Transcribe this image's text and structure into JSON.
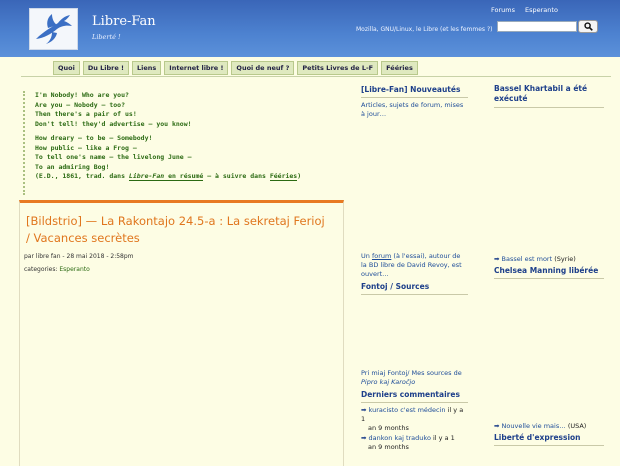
{
  "site": {
    "title": "Libre-Fan",
    "tagline": "Liberté !"
  },
  "top_links": [
    "Forums",
    "Esperanto"
  ],
  "header_blurb": "Mozilla, GNU/Linux, le Libre (et les femmes ?)",
  "search": {
    "placeholder": "",
    "button_icon": "search-icon"
  },
  "tabs": [
    "Quoi",
    "Du Libre !",
    "Liens",
    "Internet libre !",
    "Quoi de neuf ?",
    "Petits Livres de L-F",
    "Fééries"
  ],
  "poem": {
    "lines": [
      "I'm Nobody! Who are you?",
      "Are you — Nobody — too?",
      "Then there's a pair of us!",
      "Don't tell! they'd advertise — you know!",
      "How dreary — to be — Somebody!",
      "How public — like a Frog —",
      "To tell one's name — the livelong June —",
      "To an admiring Bog!"
    ],
    "credit_pre": "(E.D., 1861, trad. dans ",
    "credit_link1": "Libre-Fan",
    "credit_link2": " en résumé",
    "credit_mid": " — à suivre dans ",
    "credit_link3": "Fééries",
    "credit_post": ")"
  },
  "article": {
    "title": "[Bildstrio] — La Rakontajo 24.5-a : La sekretaj Ferioj / Vacances secrètes",
    "meta": "par libre fan - 28 mai 2018 - 2:58pm",
    "categories_label": "categories: ",
    "category": "Esperanto"
  },
  "middle_col": {
    "news_title": "[Libre-Fan] Nouveautés",
    "news_text": "Articles, sujets de forum, mises à jour…",
    "forum_text_pre": "Un ",
    "forum_link": "forum",
    "forum_text_post": " (à l'essai), autour de la BD libre de David Revoy, est ouvert…",
    "fontoj_title": "Fontoj / Sources",
    "fontoj_text_pre": "Pri miaj Fontoj/ Mes sources de ",
    "fontoj_text_em": "Pipro kaj Karoĉjo",
    "comments_title": "Derniers commentaires",
    "comments": [
      {
        "text": "kuracisto c'est médecin",
        "by": " il y a 1",
        "ago": "an 9 months"
      },
      {
        "text": "dankon kaj traduko",
        "by": " il y a 1",
        "ago": "an 9 months"
      }
    ]
  },
  "right_col": {
    "h1": "Bassel Khartabil a été exécuté",
    "item1_link": "Bassel est mort",
    "item1_suffix": " (Syrie)",
    "h2": "Chelsea Manning libérée",
    "item2_link": "Nouvelle vie mais…",
    "item2_suffix": " (USA)",
    "h3": "Liberté d'expression"
  }
}
